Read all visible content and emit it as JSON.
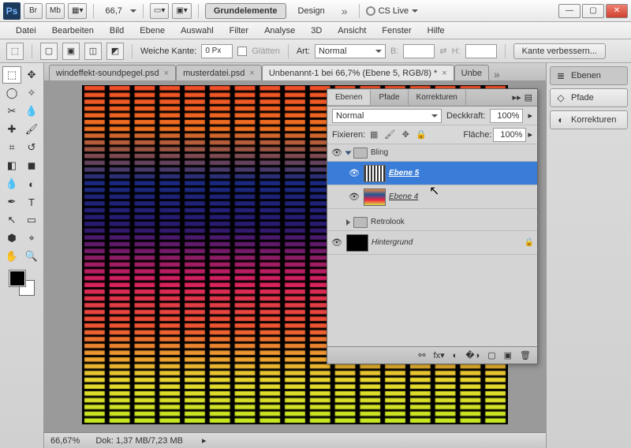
{
  "titlebar": {
    "logo": "Ps",
    "br": "Br",
    "mb": "Mb",
    "zoom": "66,7",
    "tab1": "Grundelemente",
    "tab2": "Design",
    "cslive": "CS Live"
  },
  "menu": {
    "items": [
      "Datei",
      "Bearbeiten",
      "Bild",
      "Ebene",
      "Auswahl",
      "Filter",
      "Analyse",
      "3D",
      "Ansicht",
      "Fenster",
      "Hilfe"
    ]
  },
  "options": {
    "weiche": "Weiche Kante:",
    "weiche_val": "0 Px",
    "glatten": "Glätten",
    "art": "Art:",
    "art_val": "Normal",
    "b": "B:",
    "h": "H:",
    "verbessern": "Kante verbessern..."
  },
  "tabs": {
    "t1": "windeffekt-soundpegel.psd",
    "t2": "musterdatei.psd",
    "t3": "Unbenannt-1 bei 66,7% (Ebene 5, RGB/8) *",
    "t4": "Unbe"
  },
  "rpanel": {
    "ebenen": "Ebenen",
    "pfade": "Pfade",
    "korrekturen": "Korrekturen"
  },
  "layers": {
    "tabs": {
      "ebenen": "Ebenen",
      "pfade": "Pfade",
      "korrekturen": "Korrekturen"
    },
    "blend": "Normal",
    "deckkraft": "Deckkraft:",
    "deckkraft_v": "100%",
    "fixieren": "Fixieren:",
    "flache": "Fläche:",
    "flache_v": "100%",
    "g1": "Bling",
    "l1": "Ebene 5",
    "l2": "Ebene 4",
    "g2": "Retrolook",
    "bg": "Hintergrund"
  },
  "status": {
    "zoom": "66,67%",
    "dok": "Dok: 1,37 MB/7,23 MB"
  }
}
